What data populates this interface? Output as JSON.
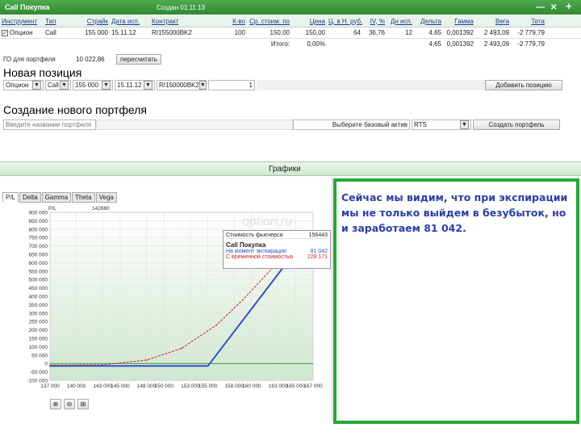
{
  "topbar": {
    "title": "Call Покупка",
    "created": "Создан 01.11.13",
    "min_icon": "—",
    "close_icon": "✕",
    "add_icon": "+"
  },
  "table": {
    "headers": [
      "Инструмент",
      "Тип",
      "Страйк",
      "Дата исп.",
      "Контракт",
      "К-во",
      "Ср. стоим. по",
      "Цена",
      "Ц. в Н. руб.",
      "IV, %",
      "Дн исп.",
      "Дельта",
      "Гамма",
      "Вега",
      "Тета"
    ],
    "row": [
      "Опцион",
      "Call",
      "155 000",
      "15.11.12",
      "RI155000BK2",
      "100",
      "150,00",
      "150,00",
      "64",
      "36,76",
      "12",
      "4,65",
      "0,001392",
      "2 493,09",
      "-2 779,79"
    ],
    "total_label": "Итого:",
    "total": [
      "0,00%",
      "",
      "",
      "",
      "4,65",
      "0,001392",
      "2 493,09",
      "-2 779,79"
    ]
  },
  "go": {
    "label": "ГО для портфеля",
    "value": "10 022,86",
    "button": "пересчитать"
  },
  "new_position": {
    "title": "Новая позиция",
    "type_value": "Опцион",
    "kind_value": "Call",
    "strike_value": "155 000",
    "date_value": "15.11.12",
    "contract_value": "RI150000BK2",
    "qty_value": "1",
    "add_button": "Добавить позицию"
  },
  "new_portfolio": {
    "title": "Создание нового портфеля",
    "name_placeholder": "Введите название портфеля",
    "asset_label": "Выберите базовый актив",
    "asset_value": "RTS",
    "create_button": "Создать портфель"
  },
  "charts": {
    "title": "Графики",
    "tabs": [
      "P/L",
      "Delta",
      "Gamma",
      "Theta",
      "Vega"
    ],
    "tooltip": {
      "futures_label": "Стоимость фьючерса",
      "futures_value": "156443",
      "title": "Call Покупка",
      "expiry_label": "На момент экспирации",
      "expiry_value": "81 042",
      "time_label": "С временной стоимостью",
      "time_value": "228 171"
    },
    "watermark": "option.ru"
  },
  "annotation": {
    "text": "Сейчас мы видим, что при экспирации мы не только выйдем в безубыток, но и заработаем 81 042."
  },
  "colors": {
    "green": "#3d9a3d",
    "expiry_line": "#2f4fd0",
    "time_line": "#d02020",
    "annotation_border": "#22aa33",
    "annotation_text": "#2a3faa"
  },
  "chart_data": {
    "type": "line",
    "title": "",
    "xlabel": "",
    "ylabel": "",
    "x": [
      137000,
      140000,
      143000,
      145000,
      148000,
      150000,
      153000,
      155000,
      158000,
      160000,
      163000,
      165000,
      167000
    ],
    "x_ticks": [
      "137 000",
      "140 000",
      "143 000",
      "145 000",
      "148 000",
      "150 000",
      "153 000",
      "155 000",
      "158 000",
      "160 000",
      "163 000",
      "165 000",
      "167 000"
    ],
    "y_ticks": [
      "-100 000",
      "-50 000",
      "0",
      "50 000",
      "100 000",
      "150 000",
      "200 000",
      "250 000",
      "300 000",
      "350 000",
      "400 000",
      "450 000",
      "500 000",
      "550 000",
      "600 000",
      "650 000",
      "700 000",
      "750 000",
      "800 000",
      "850 000",
      "900 000"
    ],
    "ylim": [
      -100000,
      900000
    ],
    "xlim": [
      137000,
      167000
    ],
    "top_left_label": "P/L",
    "top_right_label": "142680",
    "series": [
      {
        "name": "На момент экспирации",
        "color": "#2f4fd0",
        "x": [
          137000,
          155000,
          164000
        ],
        "y": [
          -15000,
          -15000,
          600000
        ]
      },
      {
        "name": "С временной стоимостью",
        "color": "#d02020",
        "x": [
          137000,
          143000,
          148000,
          152000,
          156000,
          159000,
          164000
        ],
        "y": [
          -10000,
          -8000,
          20000,
          90000,
          230000,
          380000,
          660000
        ]
      }
    ]
  }
}
